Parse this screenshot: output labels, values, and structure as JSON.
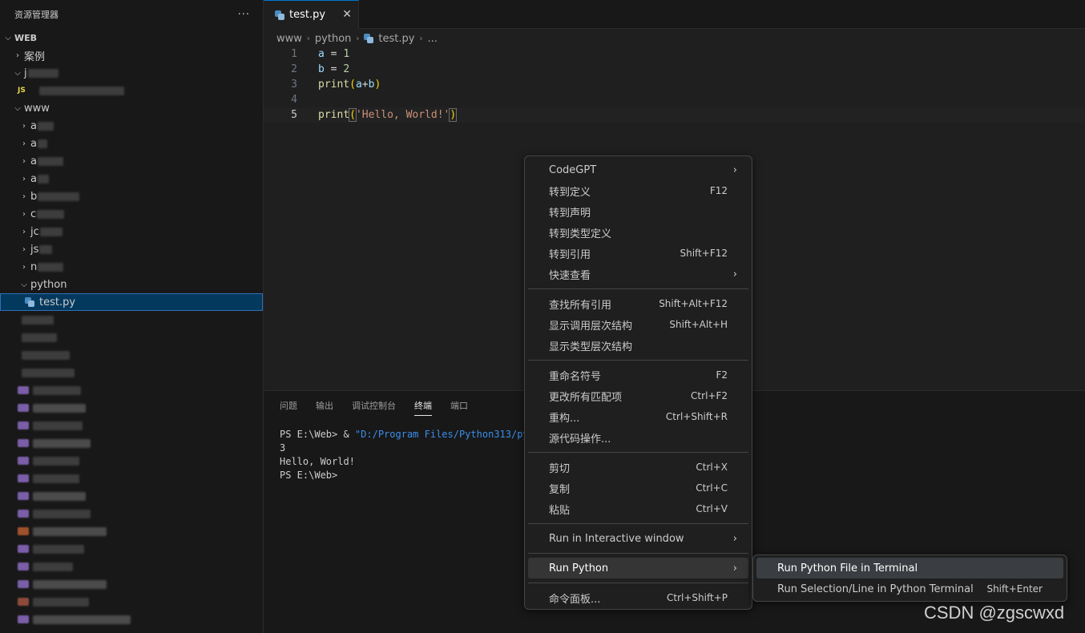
{
  "explorer": {
    "title": "资源管理器",
    "more": "···",
    "root": "WEB",
    "items": [
      {
        "label": "案例",
        "kind": "folder",
        "depth": 1
      },
      {
        "label": "j",
        "kind": "folder-open",
        "depth": 1
      },
      {
        "label": "JS",
        "kind": "js-file",
        "depth": 2
      },
      {
        "label": "www",
        "kind": "folder-open",
        "depth": 1
      },
      {
        "label": "a",
        "kind": "folder",
        "depth": 2
      },
      {
        "label": "a",
        "kind": "folder",
        "depth": 2
      },
      {
        "label": "a",
        "kind": "folder",
        "depth": 2
      },
      {
        "label": "a",
        "kind": "folder",
        "depth": 2
      },
      {
        "label": "b",
        "kind": "folder",
        "depth": 2
      },
      {
        "label": "c",
        "kind": "folder",
        "depth": 2
      },
      {
        "label": "jc",
        "kind": "folder",
        "depth": 2
      },
      {
        "label": "js",
        "kind": "folder",
        "depth": 2
      },
      {
        "label": "n",
        "kind": "folder",
        "depth": 2
      },
      {
        "label": "python",
        "kind": "folder-open",
        "depth": 2
      },
      {
        "label": "test.py",
        "kind": "py-file",
        "depth": 3,
        "selected": true
      }
    ]
  },
  "editor": {
    "tab_label": "test.py",
    "tab_close": "✕",
    "breadcrumb": [
      "www",
      "python",
      "test.py",
      "..."
    ],
    "lines": [
      {
        "n": "1",
        "text": "a = 1"
      },
      {
        "n": "2",
        "text": "b = 2"
      },
      {
        "n": "3",
        "text": "print(a+b)"
      },
      {
        "n": "4",
        "text": ""
      },
      {
        "n": "5",
        "text": "print('Hello, World!')"
      }
    ]
  },
  "panel": {
    "tabs": [
      "问题",
      "输出",
      "调试控制台",
      "终端",
      "端口"
    ],
    "active_tab": "终端",
    "terminal": {
      "l1_prefix": "PS E:\\Web> & ",
      "l1_string": "\"D:/Program Files/Python313/pyt",
      "l2": "3",
      "l3": "Hello, World!",
      "l4": "PS E:\\Web>"
    }
  },
  "context_menu": {
    "groups": [
      [
        {
          "label": "CodeGPT",
          "key": "",
          "submenu": true
        },
        {
          "label": "转到定义",
          "key": "F12"
        },
        {
          "label": "转到声明",
          "key": ""
        },
        {
          "label": "转到类型定义",
          "key": ""
        },
        {
          "label": "转到引用",
          "key": "Shift+F12"
        },
        {
          "label": "快速查看",
          "key": "",
          "submenu": true
        }
      ],
      [
        {
          "label": "查找所有引用",
          "key": "Shift+Alt+F12"
        },
        {
          "label": "显示调用层次结构",
          "key": "Shift+Alt+H"
        },
        {
          "label": "显示类型层次结构",
          "key": ""
        }
      ],
      [
        {
          "label": "重命名符号",
          "key": "F2"
        },
        {
          "label": "更改所有匹配项",
          "key": "Ctrl+F2"
        },
        {
          "label": "重构...",
          "key": "Ctrl+Shift+R"
        },
        {
          "label": "源代码操作...",
          "key": ""
        }
      ],
      [
        {
          "label": "剪切",
          "key": "Ctrl+X"
        },
        {
          "label": "复制",
          "key": "Ctrl+C"
        },
        {
          "label": "粘贴",
          "key": "Ctrl+V"
        }
      ],
      [
        {
          "label": "Run in Interactive window",
          "key": "",
          "submenu": true
        }
      ],
      [
        {
          "label": "Run Python",
          "key": "",
          "submenu": true,
          "highlighted": true
        }
      ],
      [
        {
          "label": "命令面板...",
          "key": "Ctrl+Shift+P"
        }
      ]
    ],
    "arrow": "›"
  },
  "submenu": {
    "items": [
      {
        "label": "Run Python File in Terminal",
        "key": "",
        "highlighted": true
      },
      {
        "label": "Run Selection/Line in Python Terminal",
        "key": "Shift+Enter"
      }
    ]
  },
  "watermark": "CSDN @zgscwxd",
  "colors": {
    "accent": "#0078d4",
    "selection": "#04395e",
    "python_blue": "#4b8bbe"
  }
}
